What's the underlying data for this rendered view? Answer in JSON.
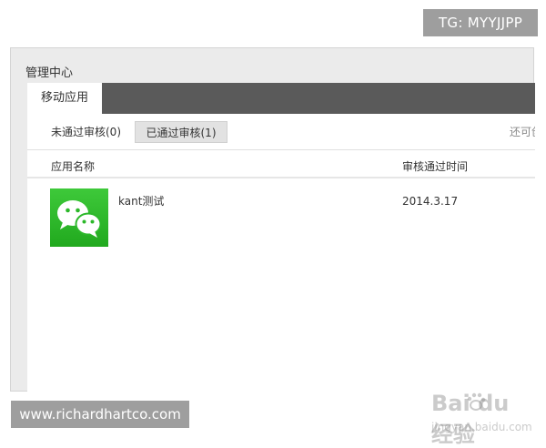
{
  "badges": {
    "tg": "TG: MYYJJPP",
    "website": "www.richardhartco.com"
  },
  "panel": {
    "title": "管理中心",
    "active_tab": "移动应用"
  },
  "filters": {
    "not_approved": "未通过审核(0)",
    "approved": "已通过审核(1)",
    "right_link": "还可创"
  },
  "table": {
    "headers": {
      "app_name": "应用名称",
      "approval_time": "审核通过时间"
    },
    "rows": [
      {
        "icon": "wechat-icon",
        "name": "kant测试",
        "time": "2014.3.17"
      }
    ]
  },
  "watermark": {
    "main": "Bai du 经验",
    "sub": "jingyan.baidu.com"
  },
  "colors": {
    "tab_bar": "#5a5a5a",
    "selected_filter_bg": "#e2e2e2",
    "wechat_green": "#2cb82a"
  }
}
